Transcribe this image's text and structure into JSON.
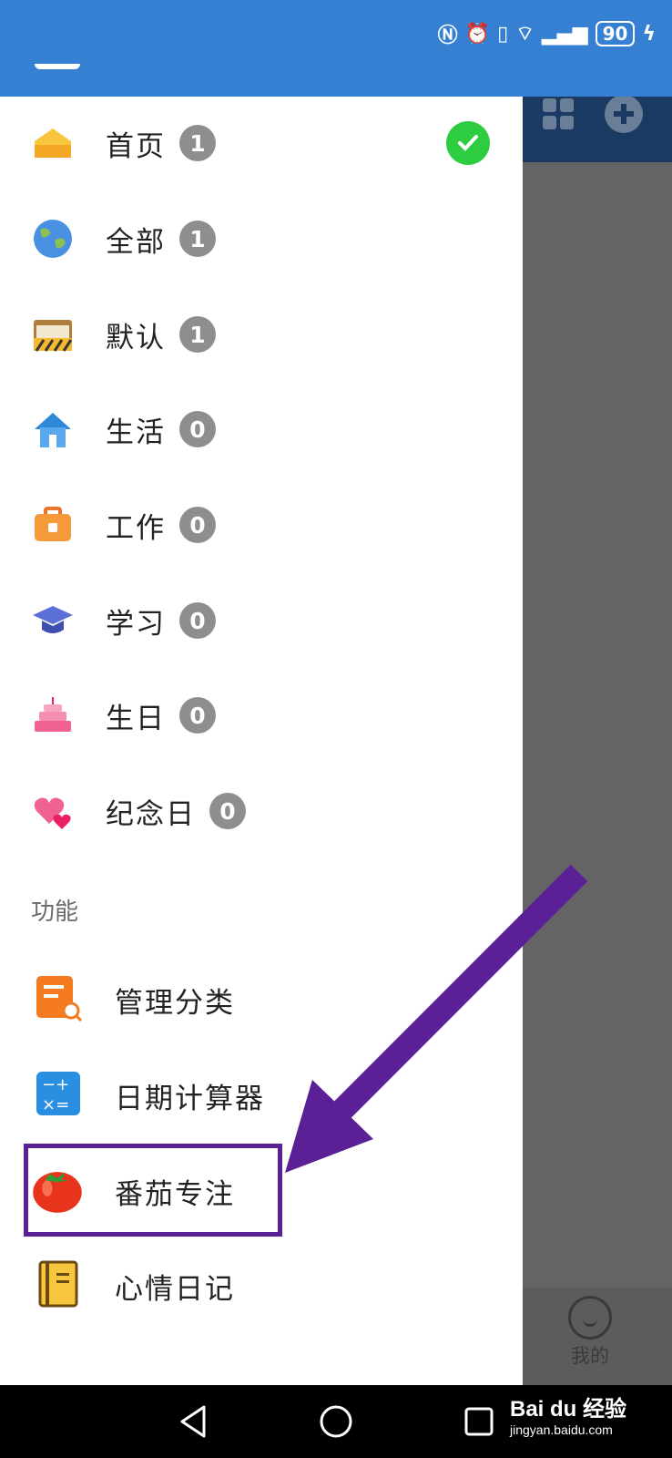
{
  "status": {
    "battery": "90"
  },
  "categories": [
    {
      "label": "首页",
      "count": "1",
      "selected": true
    },
    {
      "label": "全部",
      "count": "1"
    },
    {
      "label": "默认",
      "count": "1"
    },
    {
      "label": "生活",
      "count": "0"
    },
    {
      "label": "工作",
      "count": "0"
    },
    {
      "label": "学习",
      "count": "0"
    },
    {
      "label": "生日",
      "count": "0"
    },
    {
      "label": "纪念日",
      "count": "0"
    }
  ],
  "section_title": "功能",
  "functions": [
    {
      "label": "管理分类",
      "icon": "manage-category-icon"
    },
    {
      "label": "日期计算器",
      "icon": "calculator-icon"
    },
    {
      "label": "番茄专注",
      "icon": "tomato-icon"
    },
    {
      "label": "心情日记",
      "icon": "diary-icon"
    }
  ],
  "background": {
    "me_tab_label": "我的"
  },
  "watermark": {
    "brand": "Bai du 经验",
    "url": "jingyan.baidu.com"
  },
  "colors": {
    "status_bar": "#3580d3",
    "badge": "#8e8e8e",
    "check": "#2ecc40",
    "highlight": "#5b1f96"
  }
}
